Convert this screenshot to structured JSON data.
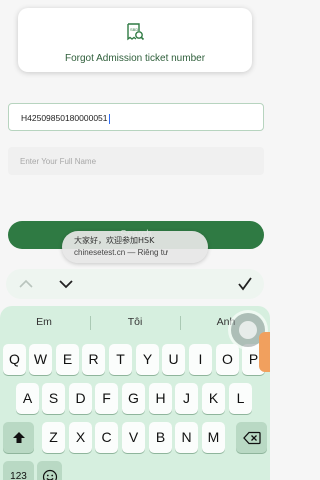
{
  "card": {
    "title": "Forgot Admission ticket number",
    "icon": "receipt-search-icon"
  },
  "form": {
    "ticket_value": "H42509850180000051",
    "name_placeholder": "Enter Your Full Name",
    "search_label": "Search"
  },
  "toast": {
    "line1": "大家好，欢迎参加HSK",
    "line2": "chinesetest.cn — Riêng tư"
  },
  "accessory": {
    "prev": "chevron-up-icon",
    "next": "chevron-down-icon",
    "done": "checkmark-icon"
  },
  "keyboard": {
    "suggestions": [
      "Em",
      "Tôi",
      "Anh"
    ],
    "row1": [
      "Q",
      "W",
      "E",
      "R",
      "T",
      "Y",
      "U",
      "I",
      "O",
      "P"
    ],
    "row2": [
      "A",
      "S",
      "D",
      "F",
      "G",
      "H",
      "J",
      "K",
      "L"
    ],
    "row3": [
      "Z",
      "X",
      "C",
      "V",
      "B",
      "N",
      "M"
    ],
    "numbers_label": "123",
    "icons": {
      "shift": "shift-icon",
      "delete": "backspace-icon",
      "emoji": "emoji-icon"
    }
  },
  "colors": {
    "accent": "#2f7a43",
    "keyboard_bg": "#d6efdf"
  }
}
